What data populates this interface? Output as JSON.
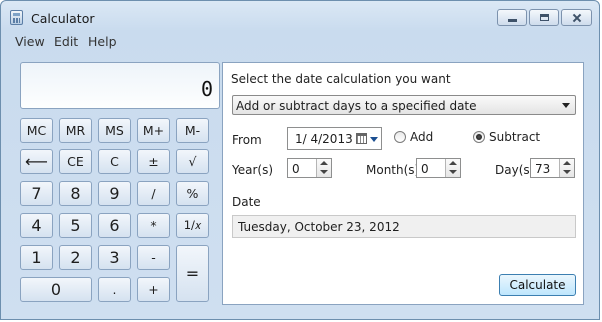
{
  "window": {
    "title": "Calculator"
  },
  "menu": [
    "View",
    "Edit",
    "Help"
  ],
  "display": {
    "value": "0"
  },
  "keys": {
    "mc": "MC",
    "mr": "MR",
    "ms": "MS",
    "mplus": "M+",
    "mminus": "M-",
    "back": "⟵",
    "ce": "CE",
    "c": "C",
    "plusminus": "±",
    "sqrt": "√",
    "seven": "7",
    "eight": "8",
    "nine": "9",
    "divide": "/",
    "percent": "%",
    "four": "4",
    "five": "5",
    "six": "6",
    "multiply": "*",
    "reciprocal": "1/𝑥",
    "one": "1",
    "two": "2",
    "three": "3",
    "minus": "-",
    "equals": "=",
    "zero": "0",
    "decimal": ".",
    "plus": "+"
  },
  "date_calc": {
    "heading": "Select the date calculation you want",
    "mode": "Add or subtract days to a specified date",
    "from_label": "From",
    "from_value": "1/  4/2013",
    "add_label": "Add",
    "subtract_label": "Subtract",
    "selected_operation": "Subtract",
    "years_label": "Year(s)",
    "years_value": "0",
    "months_label": "Month(s)",
    "months_value": "0",
    "days_label": "Day(s)",
    "days_value": "73",
    "result_label": "Date",
    "result_value": "Tuesday, October 23, 2012",
    "calculate_label": "Calculate"
  },
  "icons": {
    "app": "calculator-icon",
    "minimize": "minimize-icon",
    "maximize": "maximize-icon",
    "close": "close-icon",
    "calendar": "calendar-icon",
    "dropdown": "chevron-down-icon"
  },
  "colors": {
    "accent": "#3c7fb1",
    "frame": "#c9dbee"
  }
}
